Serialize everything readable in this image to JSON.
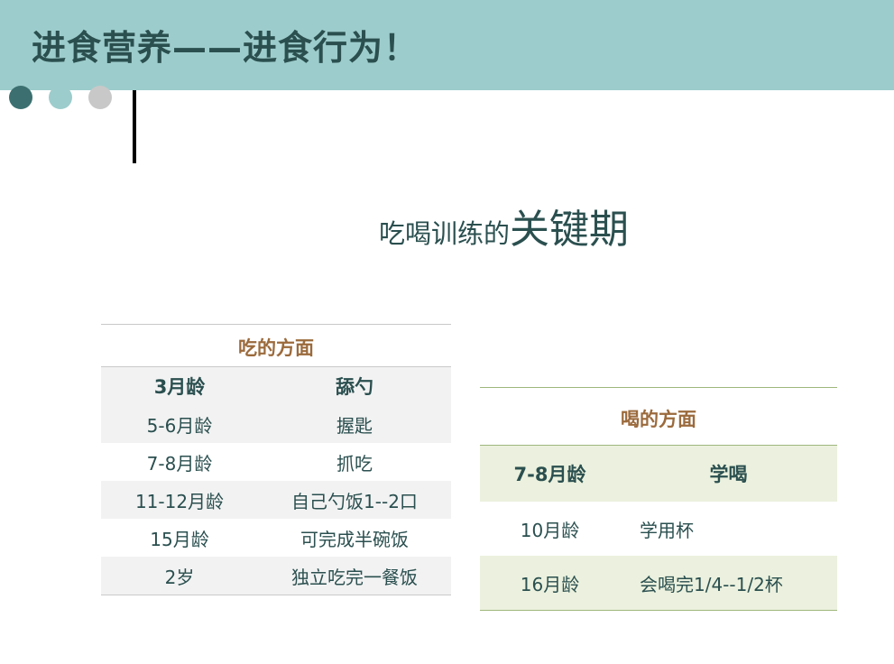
{
  "header": {
    "title": "进食营养——进食行为！",
    "band_color": "#9dcccc"
  },
  "decoration": {
    "dot_colors": [
      "#3c7070",
      "#9dcccc",
      "#c8c8c8"
    ]
  },
  "subtitle": {
    "part1": "吃喝训练的",
    "part2": "关键期"
  },
  "eating": {
    "title": "吃的方面",
    "rows": [
      {
        "age": "3月龄",
        "skill": "舔勺"
      },
      {
        "age": "5-6月龄",
        "skill": "握匙"
      },
      {
        "age": "7-8月龄",
        "skill": "抓吃"
      },
      {
        "age": "11-12月龄",
        "skill": "自己勺饭1--2口"
      },
      {
        "age": "15月龄",
        "skill": "可完成半碗饭"
      },
      {
        "age": "2岁",
        "skill": "独立吃完一餐饭"
      }
    ]
  },
  "drinking": {
    "title": "喝的方面",
    "rows": [
      {
        "age": "7-8月龄",
        "skill": "学喝"
      },
      {
        "age": "10月龄",
        "skill": "学用杯"
      },
      {
        "age": "16月龄",
        "skill": "会喝完1/4--1/2杯"
      }
    ]
  },
  "colors": {
    "title_text": "#2b4f4f",
    "table_heading": "#9b6a3c",
    "eat_shade": "#f2f2f2",
    "drink_shade": "#ebf1de"
  }
}
